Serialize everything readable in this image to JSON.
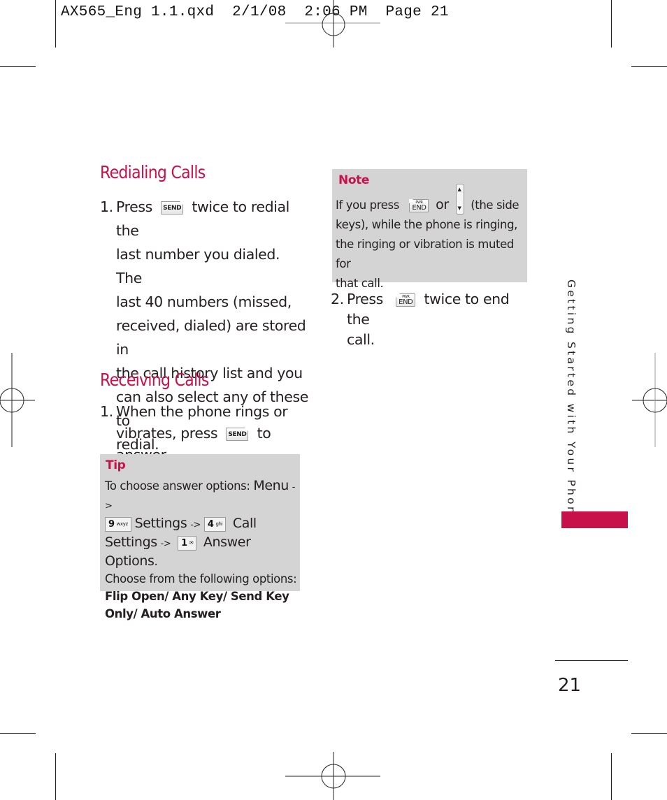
{
  "slug": {
    "text": "AX565_Eng 1.1.qxd  2/1/08  2:06 PM  Page 21"
  },
  "colors": {
    "accent": "#c8104a",
    "box_background": "#d4d4d4",
    "text": "#231f20"
  },
  "sections": {
    "redialing": {
      "heading": "Redialing Calls",
      "step1": {
        "number": "1.",
        "before_key": "Press",
        "key": "send-key-icon",
        "key_label": "SEND",
        "lines": [
          "twice to redial the",
          "last number you dialed. The",
          "last 40 numbers (missed,",
          "received, dialed) are stored in",
          "the call history list and you",
          "can also select any of these to",
          "redial."
        ]
      }
    },
    "receiving": {
      "heading": "Receiving Calls",
      "step1": {
        "number": "1.",
        "line1": "When the phone rings or",
        "line2_before": "vibrates, press",
        "key_label": "SEND",
        "line2_after": "to answer."
      }
    },
    "tip": {
      "title": "Tip",
      "intro": "To choose answer options:",
      "menu": "Menu",
      "arrow": "->",
      "key9_num": "9",
      "key9_letters": "wxyz",
      "settings": "Settings",
      "key4_num": "4",
      "key4_letters": "ghi",
      "call": "Call",
      "settings2": "Settings",
      "key1_num": "1",
      "answer_options": "Answer Options",
      "period": ".",
      "choose": "Choose from the following options:",
      "options_line1": "Flip Open/ Any Key/ Send Key",
      "options_line2": "Only/ Auto Answer"
    },
    "note": {
      "title": "Note",
      "line1_before": "If you press",
      "end_key_pwr": "PWR",
      "end_key_end": "END",
      "or": "or",
      "line1_after": "(the side",
      "line2": "keys), while the phone is ringing,",
      "line3": "the ringing or vibration is muted for",
      "line4": "that call."
    },
    "step2": {
      "number": "2.",
      "before_key": "Press",
      "key_pwr": "PWR",
      "key_end": "END",
      "after_key": "twice to end the",
      "line2": "call."
    }
  },
  "side_tab": {
    "label": "Getting Started with Your Phone"
  },
  "footer": {
    "page_number": "21"
  }
}
